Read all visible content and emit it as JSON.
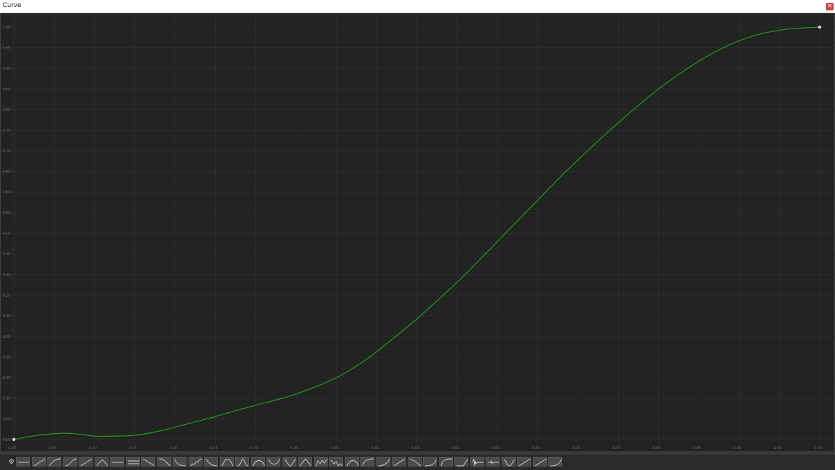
{
  "window": {
    "title": "Curve",
    "close_label": "×"
  },
  "colors": {
    "curve": "#1fa01f",
    "grid": "#2e2e2e",
    "background": "#232323",
    "tick_text": "#6e6e6e"
  },
  "chart_data": {
    "type": "line",
    "title": "",
    "xlabel": "",
    "ylabel": "",
    "xlim": [
      0,
      1
    ],
    "ylim": [
      0,
      1
    ],
    "grid": true,
    "x_ticks": [
      "0.00",
      "0.05",
      "0.10",
      "0.15",
      "0.20",
      "0.25",
      "0.30",
      "0.35",
      "0.40",
      "0.45",
      "0.50",
      "0.55",
      "0.60",
      "0.65",
      "0.70",
      "0.75",
      "0.80",
      "0.85",
      "0.90",
      "0.95",
      "1.00"
    ],
    "y_ticks": [
      "0.00",
      "0.05",
      "0.10",
      "0.15",
      "0.20",
      "0.25",
      "0.30",
      "0.35",
      "0.40",
      "0.45",
      "0.50",
      "0.55",
      "0.60",
      "0.65",
      "0.70",
      "0.75",
      "0.80",
      "0.85",
      "0.90",
      "0.95",
      "1.00"
    ],
    "series": [
      {
        "x": [
          0.0,
          0.03,
          0.06,
          0.08,
          0.1,
          0.12,
          0.15,
          0.18,
          0.21,
          0.24,
          0.27,
          0.3,
          0.33,
          0.35,
          0.38,
          0.41,
          0.44,
          0.47,
          0.5,
          0.53,
          0.56,
          0.6,
          0.64,
          0.68,
          0.72,
          0.76,
          0.8,
          0.84,
          0.88,
          0.92,
          0.96,
          1.0
        ],
        "y": [
          0.0,
          0.01,
          0.015,
          0.013,
          0.008,
          0.008,
          0.01,
          0.02,
          0.035,
          0.05,
          0.067,
          0.083,
          0.098,
          0.11,
          0.132,
          0.16,
          0.198,
          0.244,
          0.292,
          0.345,
          0.4,
          0.48,
          0.56,
          0.64,
          0.715,
          0.785,
          0.85,
          0.905,
          0.95,
          0.98,
          0.995,
          1.0
        ]
      }
    ]
  },
  "presets": {
    "gear_icon": "gear-icon",
    "items": [
      "flat-line",
      "linear",
      "ease-out",
      "ease-in-out",
      "linear-steep",
      "peak",
      "flat-line-mid",
      "double-line",
      "linear-down",
      "ease-in-down",
      "ease-out-down",
      "noise",
      "ease-out-down-steep",
      "bell",
      "bell-narrow",
      "bell-wide",
      "valley",
      "valley-narrow",
      "spike",
      "wobble",
      "wobble-down",
      "peak-round",
      "ease-out-soft",
      "ease-in-soft",
      "linear-alt",
      "ease-in-down-soft",
      "ease-in-steep",
      "ease-out-steep",
      "ease-in-flat",
      "spike-noise",
      "flat-noise",
      "wave",
      "linear-soft",
      "linear-up",
      "ease-in-late"
    ]
  }
}
